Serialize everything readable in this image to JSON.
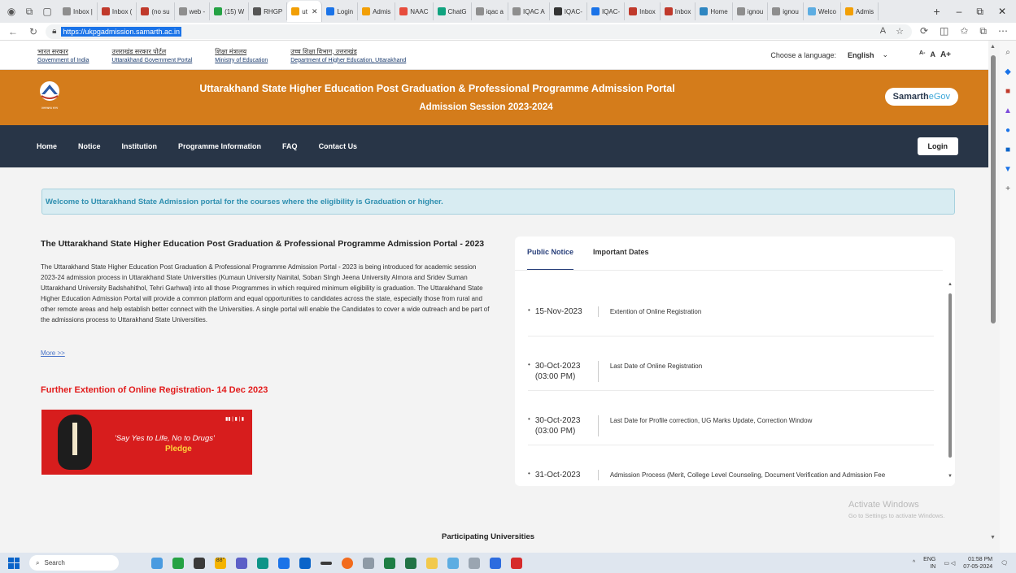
{
  "browser": {
    "tabs": [
      {
        "label": "Inbox |",
        "color": "#8e8e8e"
      },
      {
        "label": "Inbox (",
        "color": "#c0392b"
      },
      {
        "label": "(no su",
        "color": "#c0392b"
      },
      {
        "label": "web -",
        "color": "#8e8e8e"
      },
      {
        "label": "(15) W",
        "color": "#25a244"
      },
      {
        "label": "RHGP",
        "color": "#555555"
      },
      {
        "label": "ut",
        "color": "#f29f05",
        "active": true
      },
      {
        "label": "Login",
        "color": "#1a73e8"
      },
      {
        "label": "Admis",
        "color": "#f29f05"
      },
      {
        "label": "NAAC",
        "color": "#e74c3c"
      },
      {
        "label": "ChatG",
        "color": "#10a37f"
      },
      {
        "label": "iqac a",
        "color": "#8e8e8e"
      },
      {
        "label": "IQAC A",
        "color": "#8e8e8e"
      },
      {
        "label": "IQAC-",
        "color": "#333333"
      },
      {
        "label": "IQAC-",
        "color": "#1a73e8"
      },
      {
        "label": "Inbox",
        "color": "#c0392b"
      },
      {
        "label": "Inbox",
        "color": "#c0392b"
      },
      {
        "label": "Home",
        "color": "#2e86c1"
      },
      {
        "label": "ignou",
        "color": "#8e8e8e"
      },
      {
        "label": "ignou",
        "color": "#8e8e8e"
      },
      {
        "label": "Welco",
        "color": "#5dade2"
      },
      {
        "label": "Admis",
        "color": "#f29f05"
      }
    ],
    "url": "https://ukpgadmission.samarth.ac.in"
  },
  "gov_links": [
    {
      "hi": "भारत सरकार",
      "en": "Government of India"
    },
    {
      "hi": "उत्तराखंड सरकार पोर्टल",
      "en": "Uttarakhand Government Portal"
    },
    {
      "hi": "शिक्षा मंत्रालय",
      "en": "Ministry of Education"
    },
    {
      "hi": "उच्च शिक्षा विभाग, उत्तराखंड",
      "en": "Department of Higher Education, Uttarakhand"
    }
  ],
  "language": {
    "label": "Choose a language:",
    "selected": "English",
    "font_small": "A-",
    "font_normal": "A",
    "font_large": "A+"
  },
  "header": {
    "title": "Uttarakhand State Higher Education Post Graduation & Professional Programme Admission Portal",
    "session": "Admission Session 2023-2024",
    "brand_main": "Samarth",
    "brand_suffix": "eGov",
    "logo_caption": "उत्तराखण्ड राज्य"
  },
  "nav": {
    "items": [
      "Home",
      "Notice",
      "Institution",
      "Programme Information",
      "FAQ",
      "Contact Us"
    ],
    "login": "Login"
  },
  "welcome": "Welcome to Uttarakhand State Admission portal for the courses where the eligibility is Graduation or higher.",
  "about": {
    "title": "The Uttarakhand State Higher Education Post Graduation & Professional Programme Admission Portal - 2023",
    "text": "The Uttarakhand State Higher Education Post Graduation & Professional Programme Admission Portal - 2023 is being introduced for academic session 2023-24 admission process in Uttarakhand State Universities (Kumaun University Nainital, Soban SIngh Jeena University Almora and Sridev Suman Uttarakhand University Badshahithol, Tehri Garhwal) into all those Programmes in which required minimum eligibility is graduation. The Uttarakhand State Higher Education Admission Portal will provide a common platform and equal opportunities to candidates across the state, especially those from rural and other remote areas and help establish better connect with the Universities. A single portal will enable the Candidates to cover a wide outreach and be part of the admissions process to Uttarakhand State Universities.",
    "more": "More >>"
  },
  "announcement": "Further Extention of Online Registration- 14 Dec 2023",
  "banner": {
    "slogan": "'Say Yes to Life, No to Drugs'",
    "pledge": "Pledge"
  },
  "notice_panel": {
    "tabs": [
      "Public Notice",
      "Important Dates"
    ],
    "active_tab": "Public Notice",
    "items": [
      {
        "date": "15-Nov-2023",
        "time": "",
        "text": "Extention of Online Registration"
      },
      {
        "date": "30-Oct-2023",
        "time": "(03:00 PM)",
        "text": "Last Date of Online Registration"
      },
      {
        "date": "30-Oct-2023",
        "time": "(03:00 PM)",
        "text": "Last Date for Profile correction, UG Marks Update, Correction Window"
      },
      {
        "date": "31-Oct-2023",
        "time": "",
        "text": "Admission Process (Merit, College Level Counseling, Document Verification and Admission Fee"
      }
    ]
  },
  "watermark": {
    "line1": "Activate Windows",
    "line2": "Go to Settings to activate Windows."
  },
  "participating": "Participating Universities",
  "taskbar": {
    "search_placeholder": "Search",
    "weather": "88°",
    "lang": "ENG",
    "region": "IN",
    "time": "01:58 PM",
    "date": "07-05-2024"
  },
  "colors": {
    "header_orange": "#d47c1b",
    "nav_dark": "#283547",
    "alert_red": "#e21b1b",
    "welcome_blue": "#2e8fb0"
  }
}
